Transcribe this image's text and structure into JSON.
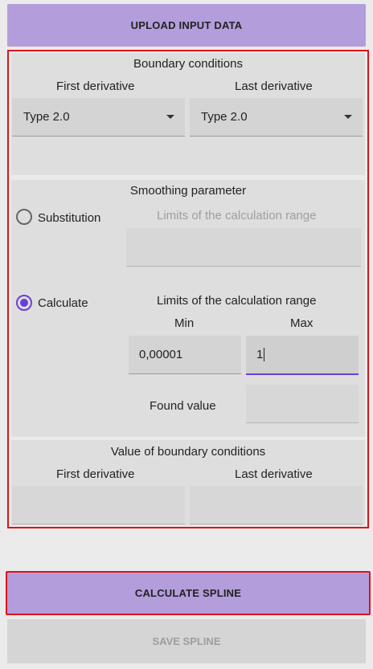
{
  "upload_button": "UPLOAD INPUT DATA",
  "boundary": {
    "title": "Boundary conditions",
    "first_label": "First derivative",
    "last_label": "Last derivative",
    "first_value": "Type 2.0",
    "last_value": "Type 2.0"
  },
  "smoothing": {
    "title": "Smoothing parameter",
    "substitution_label": "Substitution",
    "substitution_range_label": "Limits of the calculation range",
    "calculate_label": "Calculate",
    "calculate_range_label": "Limits of the calculation range",
    "min_label": "Min",
    "max_label": "Max",
    "min_value": "0,00001",
    "max_value": "1",
    "found_label": "Found value",
    "selected": "calculate"
  },
  "values": {
    "title": "Value of boundary conditions",
    "first_label": "First derivative",
    "last_label": "Last derivative"
  },
  "calculate_button": "CALCULATE SPLINE",
  "save_button": "SAVE SPLINE",
  "colors": {
    "accent": "#b39ddb",
    "focus": "#6a3ed6",
    "highlight": "#e0121a"
  }
}
